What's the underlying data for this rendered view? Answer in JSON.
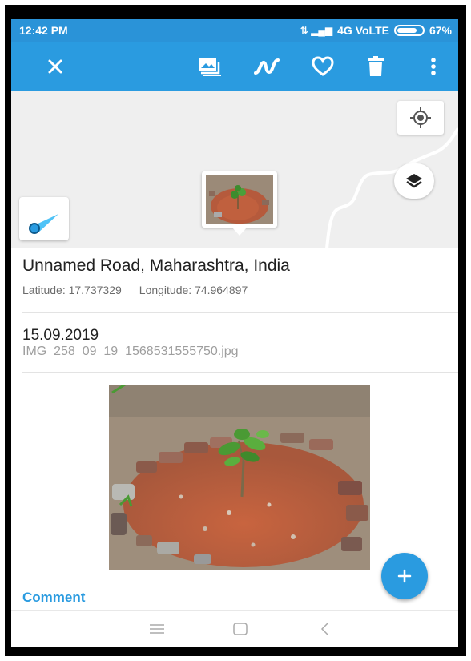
{
  "status_bar": {
    "time": "12:42 PM",
    "network": "4G VoLTE",
    "battery": "67%"
  },
  "toolbar": {
    "icons": [
      "close-icon",
      "gallery-icon",
      "track-icon",
      "heart-icon",
      "trash-icon",
      "more-vert-icon"
    ]
  },
  "map": {
    "controls": [
      "my-location-icon",
      "layers-icon",
      "compass-icon"
    ]
  },
  "location": {
    "address": "Unnamed Road, Maharashtra, India",
    "latitude": "Latitude: 17.737329",
    "longitude": "Longitude: 74.964897"
  },
  "photo_info": {
    "date": "15.09.2019",
    "filename": "IMG_258_09_19_1568531555750.jpg"
  },
  "comment_label": "Comment",
  "fab_icon": "plus-icon",
  "nav": [
    "menu-icon",
    "home-icon",
    "back-icon"
  ],
  "colors": {
    "primary": "#2a9be0",
    "status_bar": "#2a93d8",
    "map_bg": "#efefef"
  }
}
